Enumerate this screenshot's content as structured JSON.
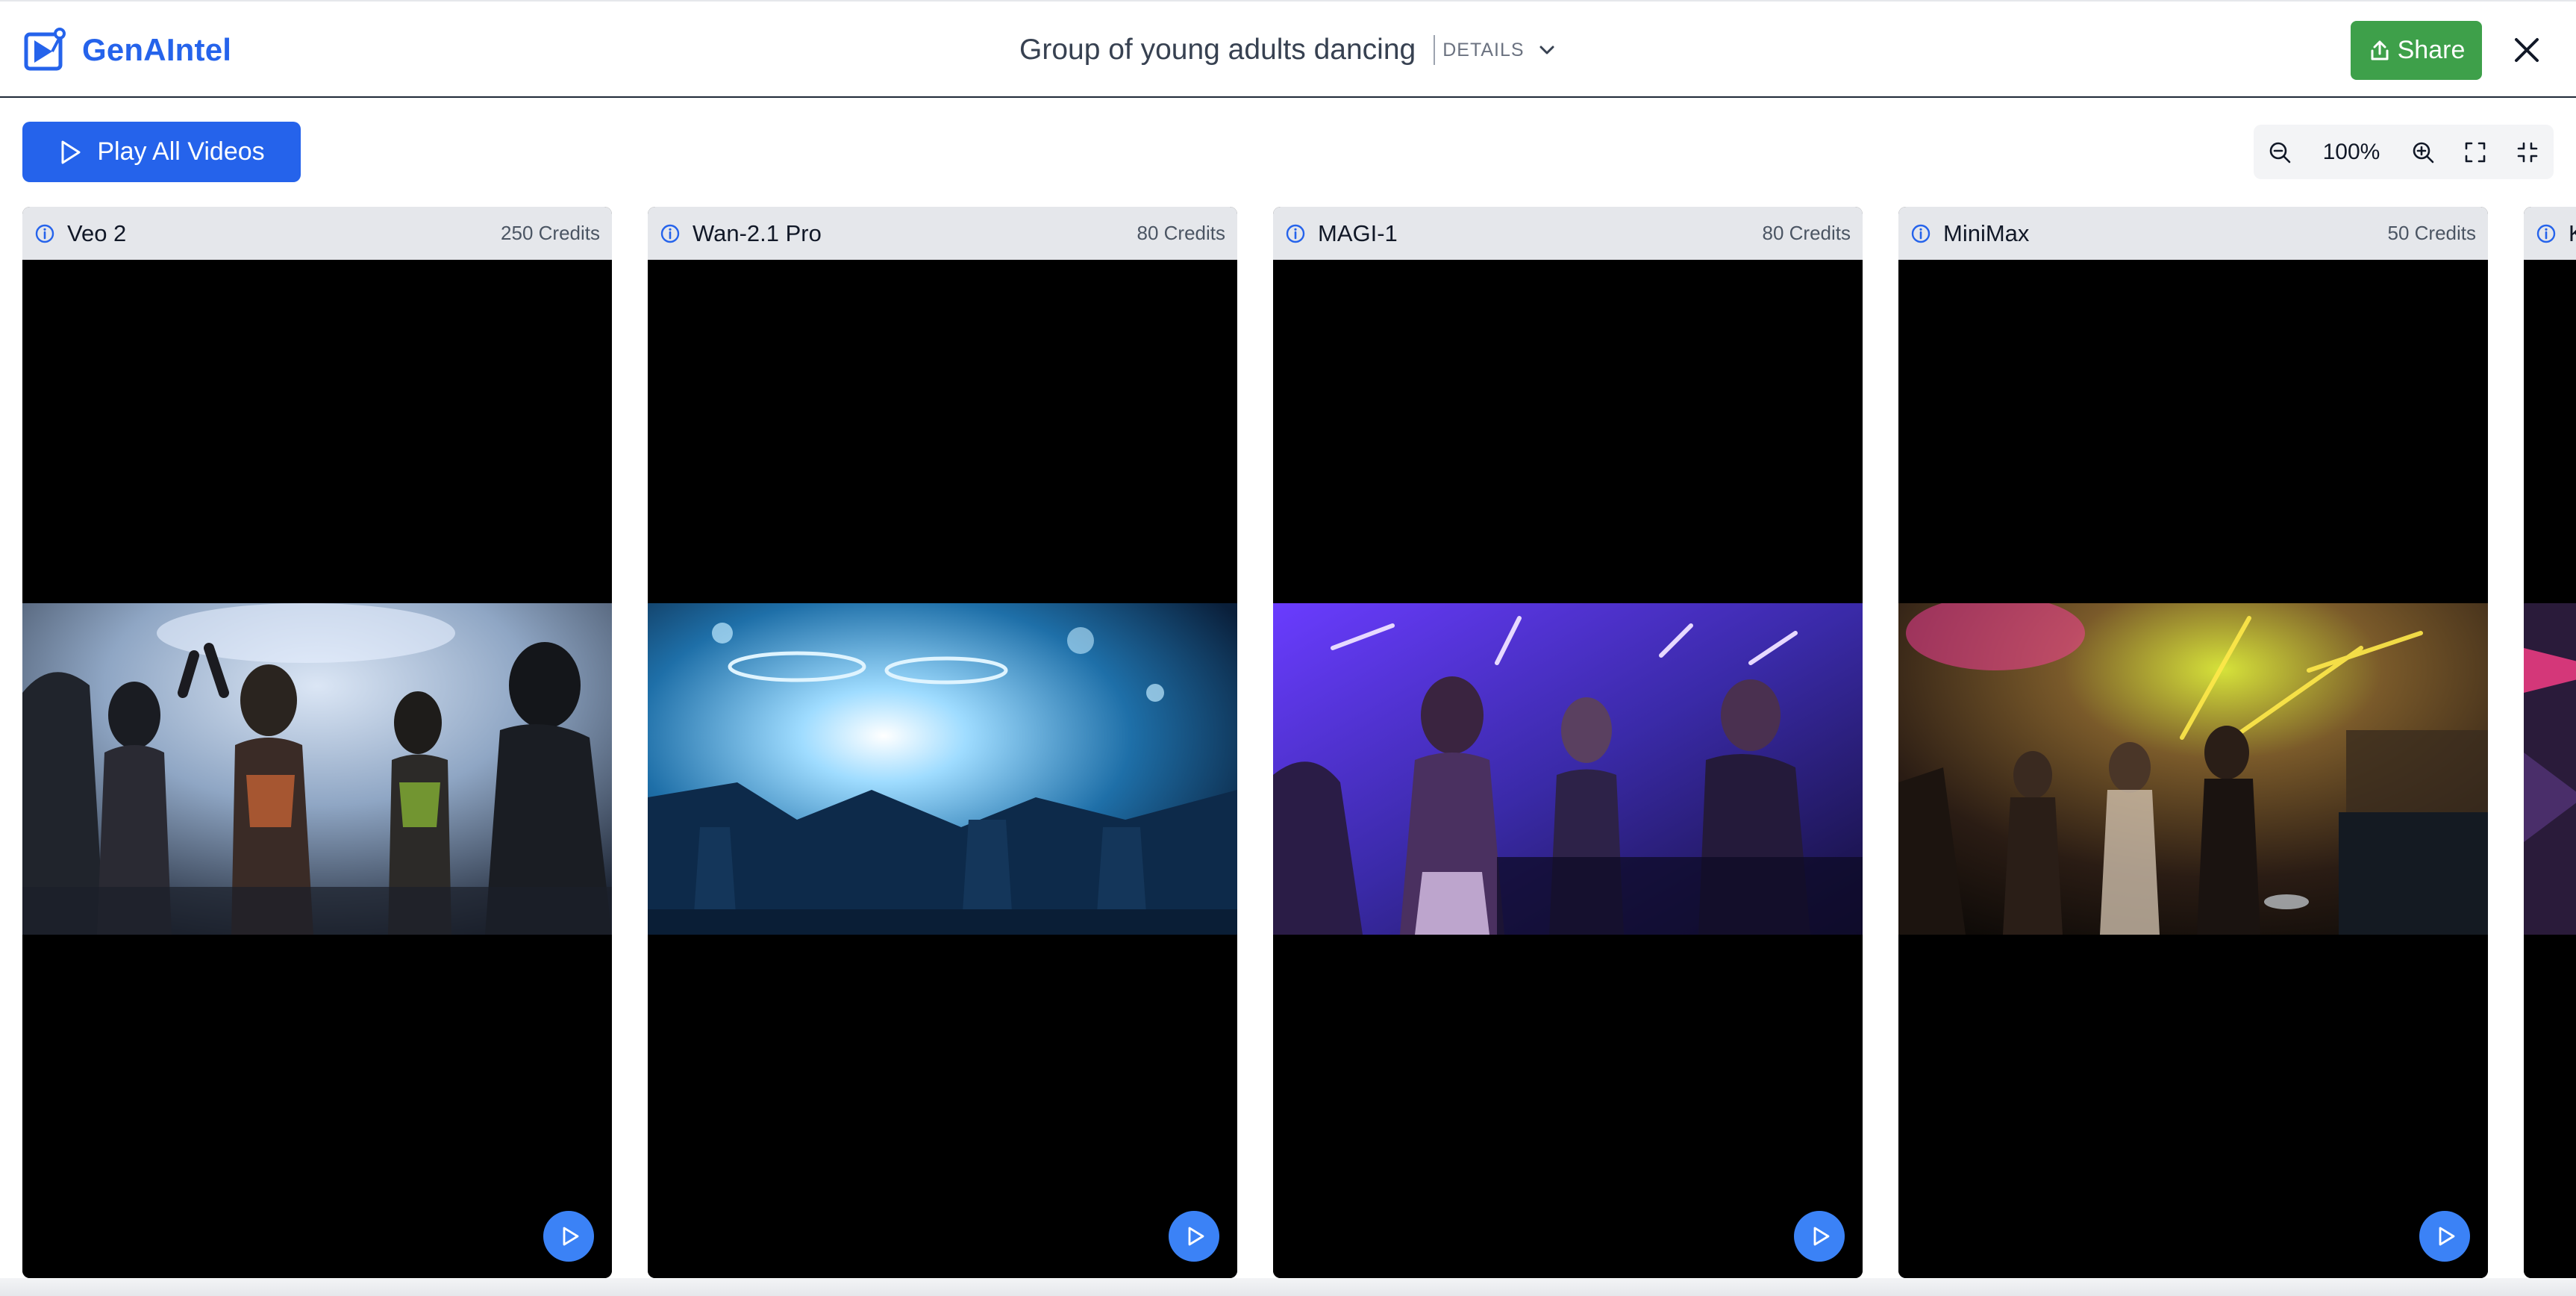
{
  "brand": {
    "name": "GenAIntel",
    "color": "#2563eb"
  },
  "header": {
    "title": "Group of young adults dancing",
    "details_label": "DETAILS",
    "share_label": "Share",
    "share_color": "#3ea04a"
  },
  "toolbar": {
    "play_all_label": "Play All Videos",
    "play_all_color": "#2563eb",
    "zoom_level": "100%"
  },
  "cards": [
    {
      "name": "Veo 2",
      "credits": "250 Credits"
    },
    {
      "name": "Wan-2.1 Pro",
      "credits": "80 Credits"
    },
    {
      "name": "MAGI-1",
      "credits": "80 Credits"
    },
    {
      "name": "MiniMax",
      "credits": "50 Credits"
    },
    {
      "name": "K",
      "credits": ""
    }
  ],
  "icons": {
    "brand": "genaintel-logo-icon",
    "details": "chevron-down-icon",
    "share": "share-upload-icon",
    "close": "close-icon",
    "play": "play-icon",
    "zoom_out": "zoom-out-icon",
    "zoom_in": "zoom-in-icon",
    "fullscreen": "fullscreen-icon",
    "exit_fullscreen": "exit-fullscreen-icon",
    "info": "info-icon"
  }
}
